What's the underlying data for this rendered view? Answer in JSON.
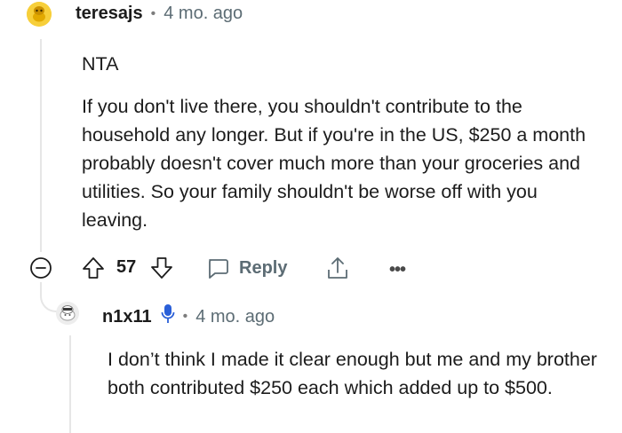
{
  "comment": {
    "username": "teresajs",
    "separator": "•",
    "time": "4 mo. ago",
    "paragraphs": [
      "NTA",
      "If you don't live there, you shouldn't contribute to the household any longer. But if you're in the US, $250 a month probably doesn't cover much more than your groceries and utilities. So your family shouldn't be worse off with you leaving."
    ],
    "actions": {
      "score": "57",
      "reply_label": "Reply",
      "more_label": "•••"
    }
  },
  "reply": {
    "username": "n1x11",
    "separator": "•",
    "time": "4 mo. ago",
    "text": "I don’t think I made it clear enough but me and my brother both contributed $250 each which added up to $500."
  },
  "colors": {
    "avatar1": "#f7cf3a",
    "mic_icon": "#2a5fd8",
    "meta_text": "#5c6c74",
    "thread_line": "#e6e6e6"
  },
  "icons": [
    "collapse-icon",
    "upvote-icon",
    "downvote-icon",
    "reply-bubble-icon",
    "share-icon",
    "more-icon",
    "microphone-icon"
  ]
}
